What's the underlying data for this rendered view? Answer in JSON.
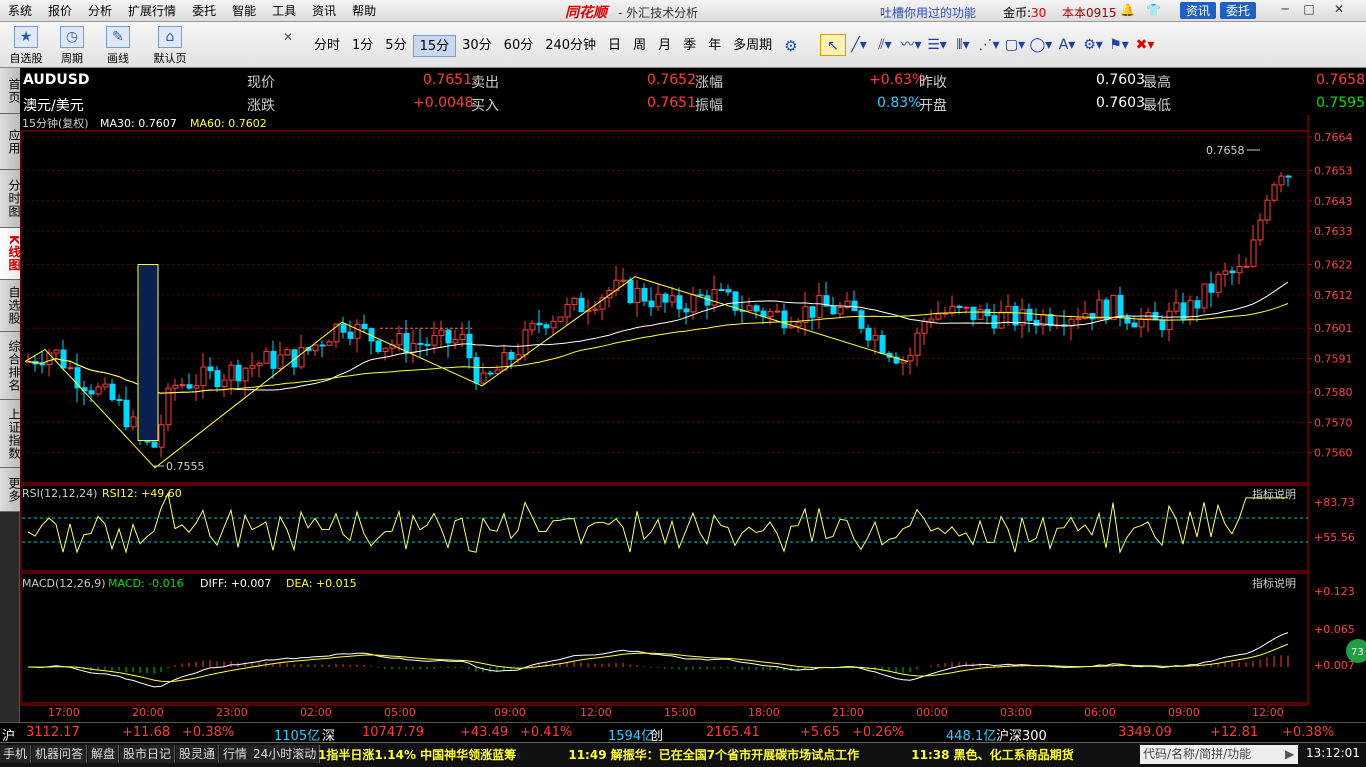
{
  "menubar": {
    "items": [
      "系统",
      "报价",
      "分析",
      "扩展行情",
      "委托",
      "智能",
      "工具",
      "资讯",
      "帮助"
    ],
    "brand": "同花顺",
    "app_title": "- 外汇技术分析",
    "slogan": "吐槽你用过的功能",
    "coins_label": "金币:",
    "coins_value": "30",
    "user": "本本0915",
    "news_btn": "资讯",
    "trade_btn": "委托",
    "win_controls": [
      "─",
      "□",
      "✕"
    ]
  },
  "toolbar": {
    "big": [
      {
        "label": "自选股",
        "icon": "star-icon"
      },
      {
        "label": "周期",
        "icon": "clock-icon"
      },
      {
        "label": "画线",
        "icon": "pencil-icon"
      },
      {
        "label": "默认页",
        "icon": "home-icon"
      }
    ],
    "periods": [
      "分时",
      "1分",
      "5分",
      "15分",
      "30分",
      "60分",
      "240分钟",
      "日",
      "周",
      "月",
      "季",
      "年",
      "多周期"
    ],
    "active_period": "15分",
    "draw_tools": [
      "cursor-icon",
      "line-icon",
      "parallel-icon",
      "wave-icon",
      "fib-icon",
      "bars-icon",
      "channel-icon",
      "rect-icon",
      "ellipse-icon",
      "text-icon",
      "gear-icon",
      "mark-icon",
      "delete-icon"
    ]
  },
  "sidetabs": [
    {
      "label": "首页",
      "active": false
    },
    {
      "label": "应用",
      "active": false
    },
    {
      "label": "分时图",
      "active": false
    },
    {
      "label": "K线图",
      "active": true
    },
    {
      "label": "自选股",
      "active": false
    },
    {
      "label": "综合排名",
      "active": false
    },
    {
      "label": "上证指数",
      "active": false
    },
    {
      "label": "更多",
      "active": false
    }
  ],
  "quote": {
    "symbol": "AUDUSD",
    "name": "澳元/美元",
    "labels": {
      "now": "现价",
      "change": "涨跌",
      "sell": "卖出",
      "buy": "买入",
      "pct": "涨幅",
      "amp": "振幅",
      "prev": "昨收",
      "open": "开盘",
      "high": "最高",
      "low": "最低"
    },
    "now": "0.7651",
    "change": "+0.0048",
    "sell": "0.7652",
    "buy": "0.7651",
    "pct": "+0.63%",
    "amp": "0.83%",
    "prev": "0.7603",
    "open": "0.7603",
    "high": "0.7658",
    "low": "0.7595"
  },
  "chart_data": {
    "type": "candlestick",
    "period_label": "15分钟(复权)",
    "ma30_label": "MA30: 0.7607",
    "ma60_label": "MA60: 0.7602",
    "ylim": [
      0.755,
      0.7666
    ],
    "y_ticks": [
      "0.7664",
      "0.7653",
      "0.7643",
      "0.7633",
      "0.7622",
      "0.7612",
      "0.7601",
      "0.7591",
      "0.7580",
      "0.7570",
      "0.7560"
    ],
    "x_ticks": [
      "17:00",
      "20:00",
      "23:00",
      "02:00",
      "05:00",
      "09:00",
      "12:00",
      "15:00",
      "18:00",
      "21:00",
      "00:00",
      "03:00",
      "06:00",
      "09:00",
      "12:00"
    ],
    "annot_high": "0.7658",
    "annot_low": "0.7555",
    "rsi": {
      "label": "RSI(12,12,24)",
      "value_label": "RSI12: +49.60",
      "explain": "指标说明",
      "y_ticks": [
        "+83.73",
        "+55.56"
      ],
      "upper": 80,
      "lower": 55.56
    },
    "macd": {
      "label": "MACD(12,26,9)",
      "macd_value": "MACD: -0.016",
      "diff_value": "DIFF: +0.007",
      "dea_value": "DEA: +0.015",
      "explain": "指标说明",
      "y_ticks": [
        "+0.123",
        "+0.065",
        "+0.007"
      ]
    },
    "side_badge": "73"
  },
  "indexbar": [
    {
      "t": "沪",
      "c": "white"
    },
    {
      "t": "3112.17",
      "c": "up"
    },
    {
      "t": "+11.68",
      "c": "up"
    },
    {
      "t": "+0.38%",
      "c": "up"
    },
    {
      "t": "1105亿",
      "c": "cyan"
    },
    {
      "t": "深",
      "c": "white"
    },
    {
      "t": "10747.79",
      "c": "up"
    },
    {
      "t": "+43.49",
      "c": "up"
    },
    {
      "t": "+0.41%",
      "c": "up"
    },
    {
      "t": "1594亿",
      "c": "cyan"
    },
    {
      "t": "创",
      "c": "white"
    },
    {
      "t": "2165.41",
      "c": "up"
    },
    {
      "t": "+5.65",
      "c": "up"
    },
    {
      "t": "+0.26%",
      "c": "up"
    },
    {
      "t": "448.1亿",
      "c": "cyan"
    },
    {
      "t": "沪深300",
      "c": "white"
    },
    {
      "t": "3349.09",
      "c": "up"
    },
    {
      "t": "+12.81",
      "c": "up"
    },
    {
      "t": "+0.38%",
      "c": "up"
    }
  ],
  "statusbar": {
    "buttons": [
      "手机",
      "机器问答",
      "解盘",
      "股市日记",
      "股灵通",
      "行情",
      "24小时滚动"
    ],
    "ticker": [
      "1指半日涨1.14% 中国神华领涨蓝筹",
      "11:49 解振华：已在全国7个省市开展碳市场试点工作",
      "11:38 黑色、化工系商品期货"
    ],
    "code_placeholder": "代码/名称/简拼/功能",
    "clock": "13:12:01"
  }
}
